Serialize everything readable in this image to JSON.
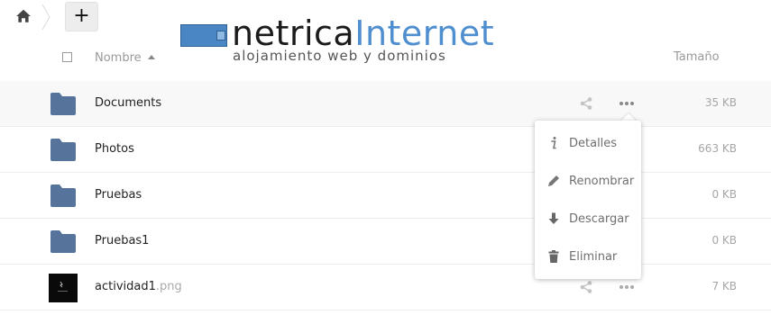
{
  "toolbar": {
    "home_icon": "home-icon",
    "new_label": "+"
  },
  "logo": {
    "title_part1": "netrica",
    "title_part2": "Internet",
    "subtitle": "alojamiento web y dominios"
  },
  "table": {
    "header_name": "Nombre",
    "header_size": "Tamaño",
    "rows": [
      {
        "name": "Documents",
        "ext": "",
        "size": "35 KB",
        "type": "folder"
      },
      {
        "name": "Photos",
        "ext": "",
        "size": "663 KB",
        "type": "folder"
      },
      {
        "name": "Pruebas",
        "ext": "",
        "size": "0 KB",
        "type": "folder"
      },
      {
        "name": "Pruebas1",
        "ext": "",
        "size": "0 KB",
        "type": "folder"
      },
      {
        "name": "actividad1",
        "ext": ".png",
        "size": "7 KB",
        "type": "image"
      }
    ]
  },
  "menu": {
    "items": [
      {
        "label": "Detalles",
        "icon": "info-icon"
      },
      {
        "label": "Renombrar",
        "icon": "pencil-icon"
      },
      {
        "label": "Descargar",
        "icon": "download-icon"
      },
      {
        "label": "Eliminar",
        "icon": "trash-icon"
      }
    ]
  },
  "colors": {
    "folder": "#55739b",
    "accent": "#4f8fcf",
    "muted_text": "#999999",
    "hover_row": "#f8f8f8"
  }
}
